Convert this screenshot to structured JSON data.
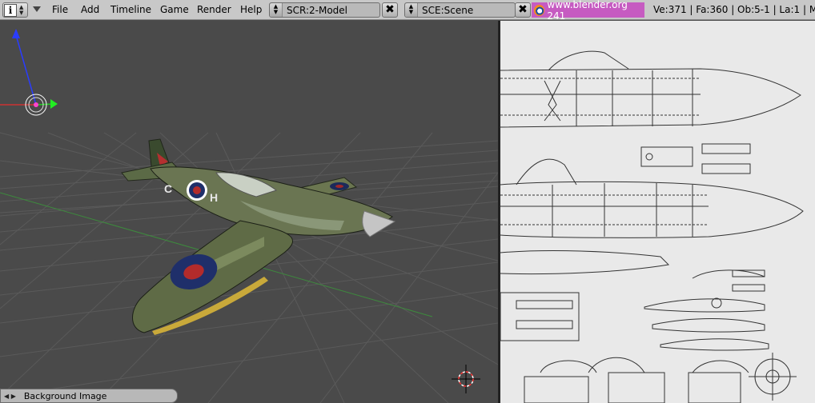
{
  "topbar": {
    "info_label": "i",
    "menu": [
      "File",
      "Add",
      "Timeline",
      "Game",
      "Render",
      "Help"
    ],
    "screen_field": "SCR:2-Model",
    "scene_field": "SCE:Scene",
    "close_glyph": "✖",
    "url": "www.blender.org 241",
    "stats": "Ve:371 | Fa:360 | Ob:5-1 | La:1 | M"
  },
  "viewport": {
    "panel_label": "Background Image",
    "panel_toggle_glyph": "◀ ▶"
  },
  "colors": {
    "header_bg": "#c8c8c8",
    "viewport_bg": "#4a4a4a",
    "url_bg": "#c65bc1",
    "blueprint_bg": "#e9e9e9"
  },
  "icons": [
    "info-icon",
    "collapse-triangle-icon",
    "close-icon",
    "blender-logo-icon",
    "transform-axis-icon",
    "3d-cursor-icon"
  ]
}
